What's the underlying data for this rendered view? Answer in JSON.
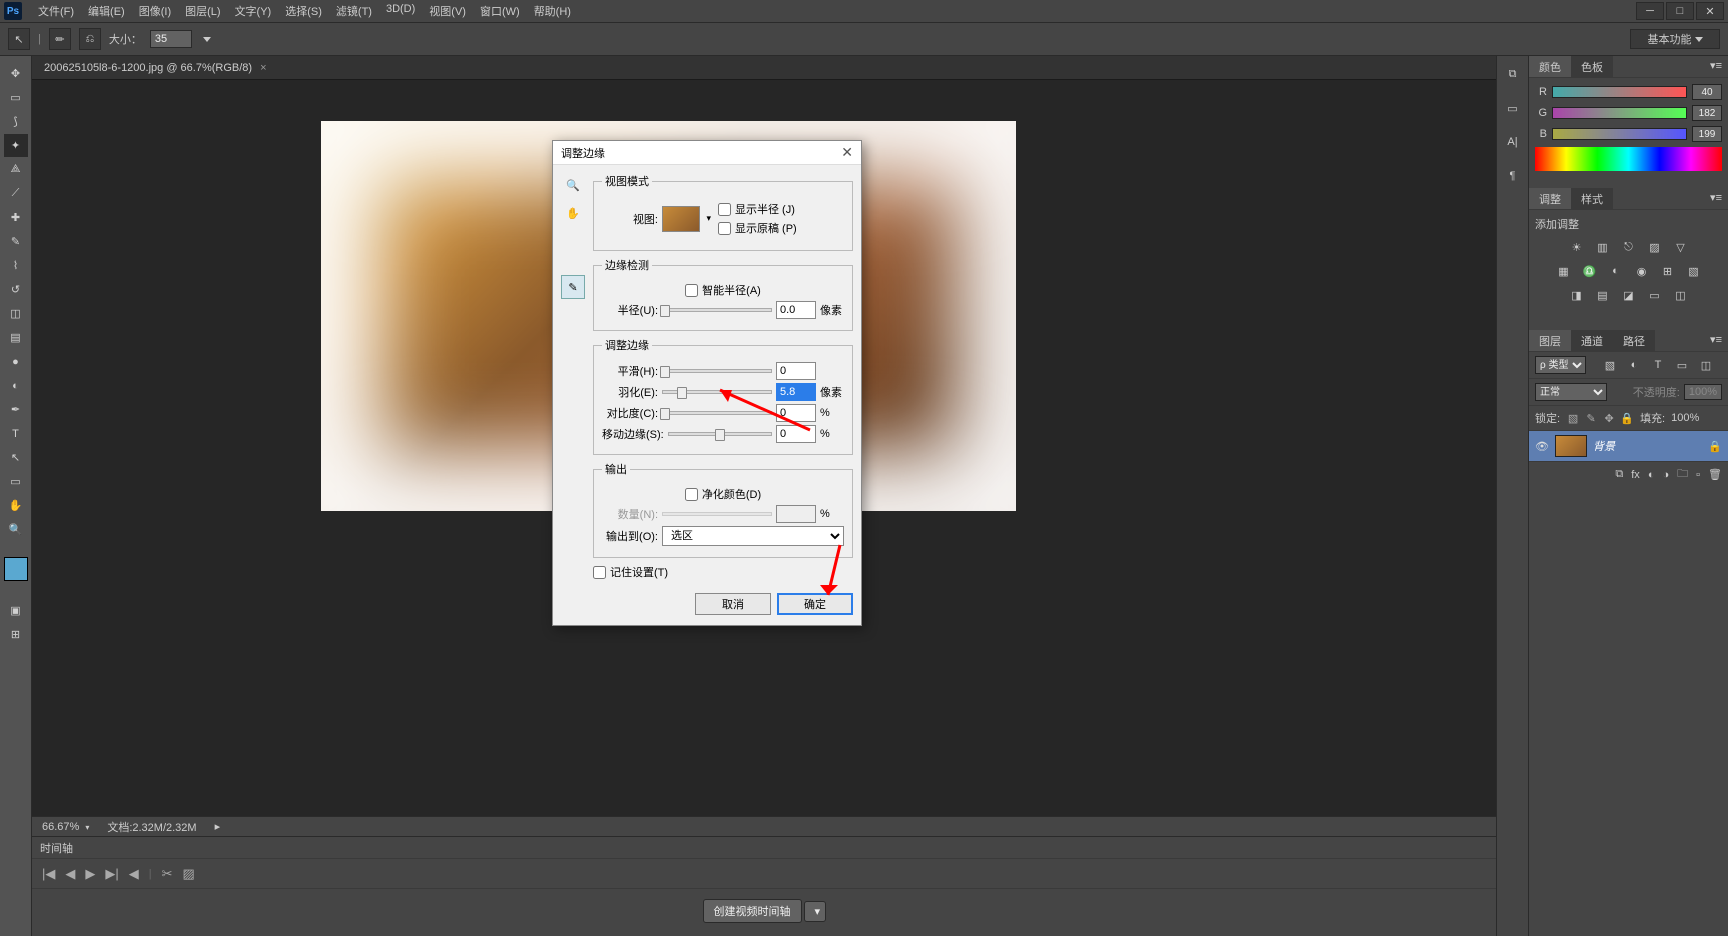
{
  "app": {
    "logo": "Ps"
  },
  "menu": {
    "file": "文件(F)",
    "edit": "编辑(E)",
    "image": "图像(I)",
    "layer": "图层(L)",
    "type": "文字(Y)",
    "select": "选择(S)",
    "filter": "滤镜(T)",
    "threed": "3D(D)",
    "view": "视图(V)",
    "window": "窗口(W)",
    "help": "帮助(H)"
  },
  "options": {
    "size_label": "大小：",
    "size_value": "35",
    "workspace": "基本功能"
  },
  "document": {
    "tab_title": "200625105l8-6-1200.jpg @ 66.7%(RGB/8)",
    "zoom": "66.67%",
    "doc_info": "文档:2.32M/2.32M"
  },
  "timeline": {
    "tab": "时间轴",
    "create_btn": "创建视频时间轴"
  },
  "panels": {
    "color": {
      "tab1": "颜色",
      "tab2": "色板",
      "r": "R",
      "g": "G",
      "b": "B",
      "r_val": "40",
      "g_val": "182",
      "b_val": "199"
    },
    "adjust": {
      "tab1": "调整",
      "tab2": "样式",
      "add": "添加调整"
    },
    "layers": {
      "tab1": "图层",
      "tab2": "通道",
      "tab3": "路径",
      "kind": "ρ 类型",
      "mode": "正常",
      "opacity_lbl": "不透明度:",
      "opacity": "100%",
      "lock_lbl": "锁定:",
      "fill_lbl": "填充:",
      "fill": "100%",
      "bg_layer": "背景"
    }
  },
  "dialog": {
    "title": "调整边缘",
    "view_mode": "视图模式",
    "view_lbl": "视图:",
    "show_radius": "显示半径 (J)",
    "show_original": "显示原稿 (P)",
    "edge_detect": "边缘检测",
    "smart_radius": "智能半径(A)",
    "radius_lbl": "半径(U):",
    "radius_val": "0.0",
    "px": "像素",
    "adjust_edge": "调整边缘",
    "smooth_lbl": "平滑(H):",
    "smooth_val": "0",
    "feather_lbl": "羽化(E):",
    "feather_val": "5.8",
    "contrast_lbl": "对比度(C):",
    "contrast_val": "0",
    "shift_lbl": "移动边缘(S):",
    "shift_val": "0",
    "pct": "%",
    "output": "输出",
    "decon": "净化颜色(D)",
    "amount_lbl": "数量(N):",
    "output_to_lbl": "输出到(O):",
    "output_to": "选区",
    "remember": "记住设置(T)",
    "ok": "确定",
    "cancel": "取消"
  }
}
